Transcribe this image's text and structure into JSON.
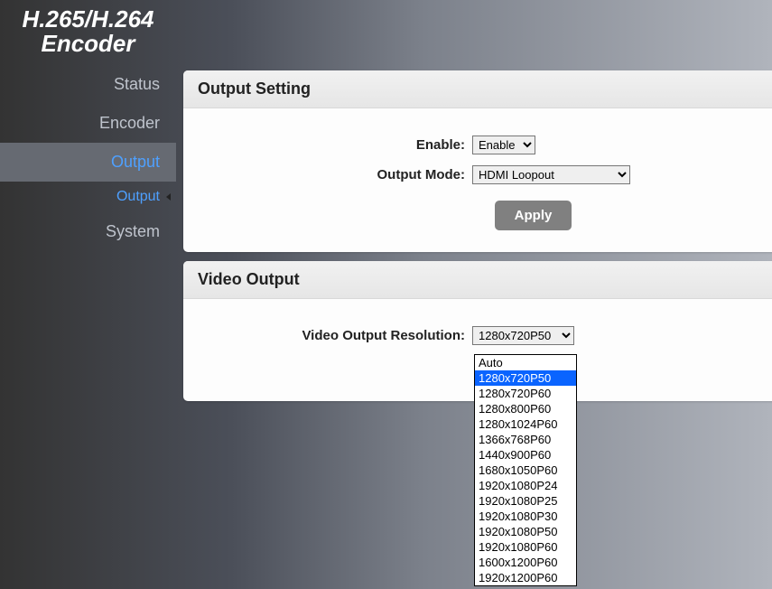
{
  "logo": {
    "line1": "H.265/H.264",
    "line2": "Encoder"
  },
  "nav": {
    "status": "Status",
    "encoder": "Encoder",
    "output": "Output",
    "output_sub": "Output",
    "system": "System"
  },
  "panel1": {
    "title": "Output Setting",
    "enable_label": "Enable:",
    "enable_value": "Enable",
    "mode_label": "Output Mode:",
    "mode_value": "HDMI Loopout",
    "apply": "Apply"
  },
  "panel2": {
    "title": "Video Output",
    "res_label": "Video Output Resolution:",
    "res_value": "1280x720P50"
  },
  "res_options": [
    "Auto",
    "1280x720P50",
    "1280x720P60",
    "1280x800P60",
    "1280x1024P60",
    "1366x768P60",
    "1440x900P60",
    "1680x1050P60",
    "1920x1080P24",
    "1920x1080P25",
    "1920x1080P30",
    "1920x1080P50",
    "1920x1080P60",
    "1600x1200P60",
    "1920x1200P60"
  ],
  "res_selected_index": 1
}
